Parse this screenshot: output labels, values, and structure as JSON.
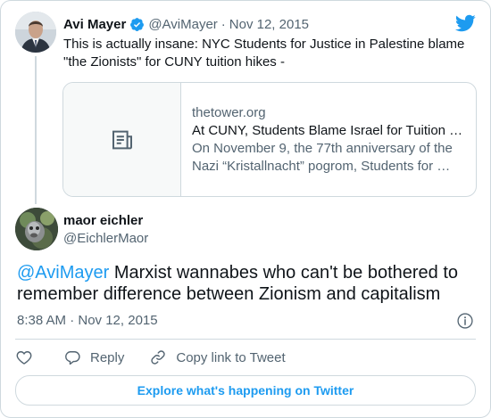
{
  "parent_tweet": {
    "author_name": "Avi Mayer",
    "author_handle": "@AviMayer",
    "separator": "·",
    "date": "Nov 12, 2015",
    "text": "This is actually insane: NYC Students for Justice in Palestine blame \"the Zionists\" for CUNY tuition hikes -",
    "verified_icon": "verified-badge-icon",
    "link_card": {
      "domain": "thetower.org",
      "title": "At CUNY, Students Blame Israel for Tuition …",
      "description": "On November 9, the 77th anniversary of the Nazi “Kristallnacht” pogrom, Students for …",
      "thumbnail_icon": "article-icon"
    }
  },
  "reply_tweet": {
    "author_name": "maor eichler",
    "author_handle": "@EichlerMaor",
    "mention": "@AviMayer",
    "text": " Marxist wannabes who can't be bothered to remember difference between Zionism and capitalism",
    "timestamp": "8:38 AM · Nov 12, 2015"
  },
  "actions": {
    "reply_label": "Reply",
    "copy_link_label": "Copy link to Tweet"
  },
  "explore_button_label": "Explore what's happening on Twitter",
  "colors": {
    "accent": "#1d9bf0",
    "text": "#0f1419",
    "secondary_text": "#536471",
    "border": "#cfd9de"
  }
}
